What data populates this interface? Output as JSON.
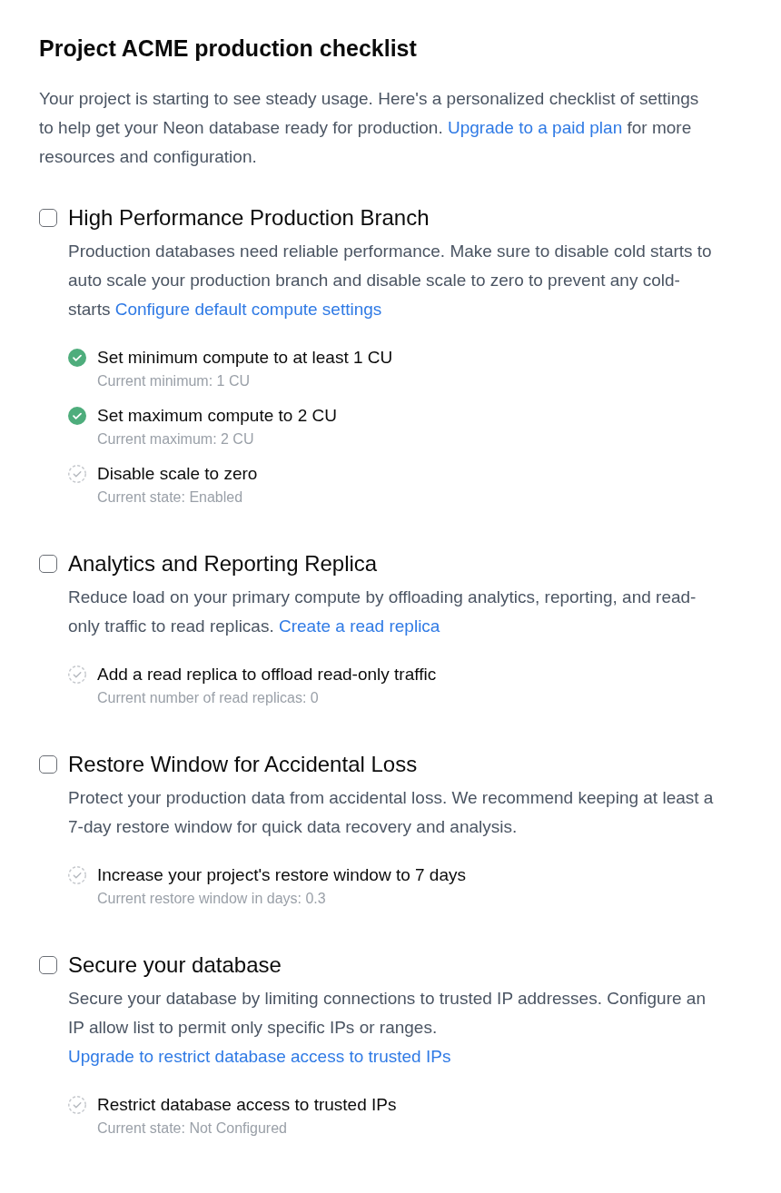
{
  "title": "Project ACME production checklist",
  "intro": {
    "text": "Your project is starting to see steady usage. Here's a personalized checklist of settings to help get your Neon database ready for production.",
    "link": "Upgrade to a paid plan",
    "text_after": "for more resources and configuration."
  },
  "sections": [
    {
      "title": "High Performance Production Branch",
      "checked": false,
      "description": "Production databases need reliable performance. Make sure to disable cold starts to auto scale your production branch and disable scale to zero to prevent any cold-starts",
      "link": "Configure default compute settings",
      "tasks": [
        {
          "label": "Set minimum compute to at least 1 CU",
          "status": "Current minimum: 1 CU",
          "completed": true
        },
        {
          "label": "Set maximum compute to 2 CU",
          "status": "Current maximum: 2 CU",
          "completed": true
        },
        {
          "label": "Disable scale to zero",
          "status": "Current state: Enabled",
          "completed": false
        }
      ]
    },
    {
      "title": "Analytics and Reporting Replica",
      "checked": false,
      "description": "Reduce load on your primary compute by offloading analytics, reporting, and read-only traffic to read replicas.",
      "link": "Create a read replica",
      "tasks": [
        {
          "label": "Add a read replica to offload read-only traffic",
          "status": "Current number of read replicas: 0",
          "completed": false
        }
      ]
    },
    {
      "title": "Restore Window for Accidental Loss",
      "checked": false,
      "description": "Protect your production data from accidental loss. We recommend keeping at least a 7-day restore window for quick data recovery and analysis.",
      "tasks": [
        {
          "label": "Increase your project's restore window to 7 days",
          "status": "Current restore window in days: 0.3",
          "completed": false
        }
      ]
    },
    {
      "title": "Secure your database",
      "checked": false,
      "description": "Secure your database by limiting connections to trusted IP addresses. Configure an IP allow list to permit only specific IPs or ranges.",
      "link": "Upgrade to restrict database access to trusted IPs",
      "tasks": [
        {
          "label": "Restrict database access to trusted IPs",
          "status": "Current state: Not Configured",
          "completed": false
        }
      ]
    }
  ]
}
